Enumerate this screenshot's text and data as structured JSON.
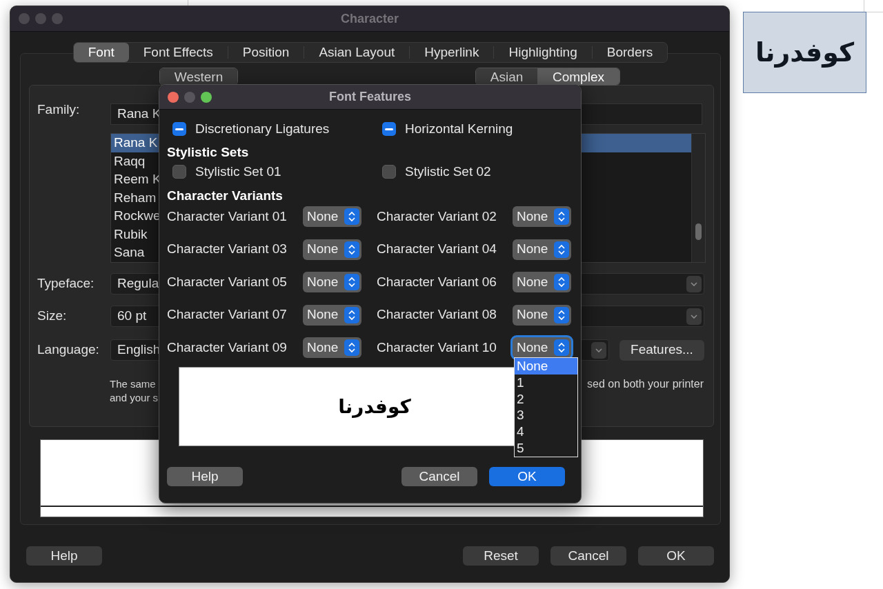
{
  "document_image": {
    "text": "كوفدرنا"
  },
  "character_dialog": {
    "title": "Character",
    "active": false,
    "tabs": [
      {
        "label": "Font",
        "selected": true
      },
      {
        "label": "Font Effects",
        "selected": false
      },
      {
        "label": "Position",
        "selected": false
      },
      {
        "label": "Asian Layout",
        "selected": false
      },
      {
        "label": "Hyperlink",
        "selected": false
      },
      {
        "label": "Highlighting",
        "selected": false
      },
      {
        "label": "Borders",
        "selected": false
      }
    ],
    "script_tabs": [
      {
        "label": "Western",
        "selected": false
      },
      {
        "label": "Asian",
        "selected": false
      },
      {
        "label": "Complex",
        "selected": true
      }
    ],
    "family": {
      "label": "Family:",
      "value": "Rana K",
      "list": [
        {
          "label": "Rana K",
          "selected": true
        },
        {
          "label": "Raqq",
          "selected": false
        },
        {
          "label": "Reem K",
          "selected": false
        },
        {
          "label": "Reham",
          "selected": false
        },
        {
          "label": "Rockwe",
          "selected": false
        },
        {
          "label": "Rubik",
          "selected": false
        },
        {
          "label": "Sana",
          "selected": false
        }
      ]
    },
    "typeface": {
      "label": "Typeface:",
      "value": "Regula"
    },
    "size": {
      "label": "Size:",
      "value": "60 pt"
    },
    "language": {
      "label": "Language:",
      "value": "English"
    },
    "features_button": "Features...",
    "note_lines": [
      "The same",
      "and your s"
    ],
    "note_right": "sed on both your printer",
    "left_buttons": [
      "Help"
    ],
    "right_buttons": [
      "Reset",
      "Cancel",
      "OK"
    ]
  },
  "font_features_dialog": {
    "title": "Font Features",
    "active": true,
    "toggles": [
      {
        "label": "Discretionary Ligatures",
        "mixed": true
      },
      {
        "label": "Horizontal Kerning",
        "mixed": true
      }
    ],
    "stylistic_sets_heading": "Stylistic Sets",
    "stylistic_sets": [
      {
        "label": "Stylistic Set 01",
        "checked": false
      },
      {
        "label": "Stylistic Set 02",
        "checked": false
      }
    ],
    "character_variants_heading": "Character Variants",
    "character_variants": [
      {
        "label": "Character Variant 01",
        "value": "None",
        "expanded": false
      },
      {
        "label": "Character Variant 02",
        "value": "None",
        "expanded": false
      },
      {
        "label": "Character Variant 03",
        "value": "None",
        "expanded": false
      },
      {
        "label": "Character Variant 04",
        "value": "None",
        "expanded": false
      },
      {
        "label": "Character Variant 05",
        "value": "None",
        "expanded": false
      },
      {
        "label": "Character Variant 06",
        "value": "None",
        "expanded": false
      },
      {
        "label": "Character Variant 07",
        "value": "None",
        "expanded": false
      },
      {
        "label": "Character Variant 08",
        "value": "None",
        "expanded": false
      },
      {
        "label": "Character Variant 09",
        "value": "None",
        "expanded": false
      },
      {
        "label": "Character Variant 10",
        "value": "None",
        "expanded": true
      }
    ],
    "dropdown_options": [
      {
        "label": "None",
        "selected": true
      },
      {
        "label": "1",
        "selected": false
      },
      {
        "label": "2",
        "selected": false
      },
      {
        "label": "3",
        "selected": false
      },
      {
        "label": "4",
        "selected": false
      },
      {
        "label": "5",
        "selected": false
      }
    ],
    "preview_text": "كوفدرنا",
    "help_button": "Help",
    "buttons": [
      {
        "label": "Cancel",
        "default": false
      },
      {
        "label": "OK",
        "default": true
      }
    ]
  }
}
